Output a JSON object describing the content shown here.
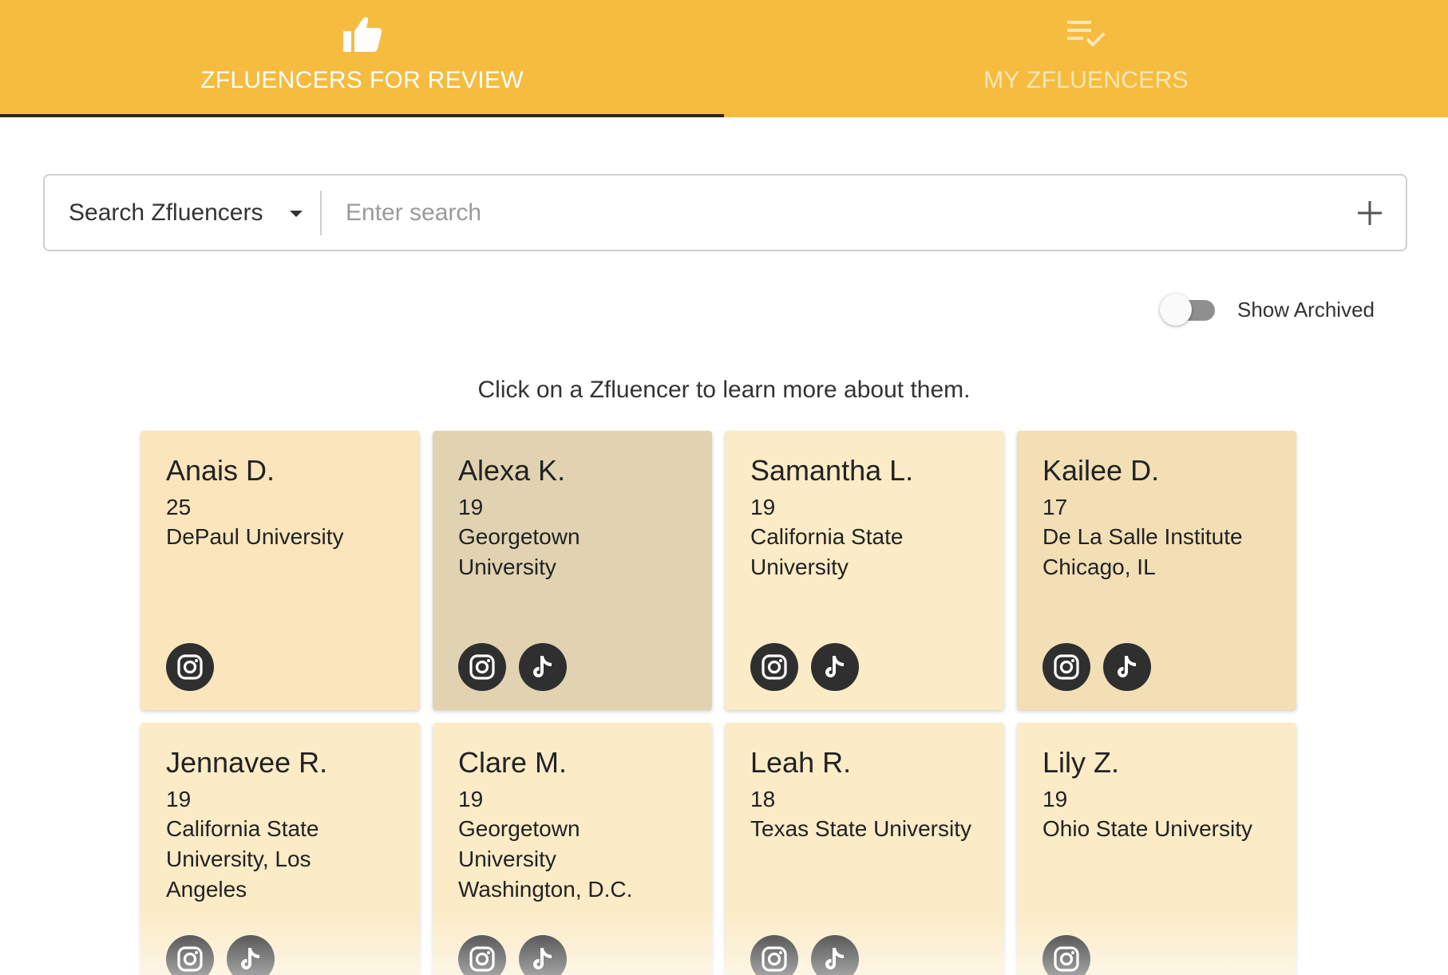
{
  "tabs": [
    {
      "label": "ZFLUENCERS FOR REVIEW",
      "icon": "thumbs-up-icon",
      "active": true
    },
    {
      "label": "MY ZFLUENCERS",
      "icon": "playlist-check-icon",
      "active": false
    }
  ],
  "search": {
    "select_label": "Search Zfluencers",
    "placeholder": "Enter search",
    "add_icon": "plus-icon"
  },
  "archived": {
    "label": "Show Archived",
    "on": false
  },
  "hint": "Click on a Zfluencer to learn more about them.",
  "colors": {
    "accent": "#f5bc40",
    "card_light": "#fbeac0",
    "card_selected": "#e1d3b1",
    "card_hover": "#f0dcb0",
    "card_default": "#fbebc6",
    "social_bg": "#2f2f2f"
  },
  "cards": [
    {
      "name": "Anais D.",
      "age": "25",
      "info": [
        "DePaul University"
      ],
      "socials": [
        "instagram-icon"
      ],
      "bg": "#fae5bc"
    },
    {
      "name": "Alexa K.",
      "age": "19",
      "info": [
        "Georgetown",
        "University"
      ],
      "socials": [
        "instagram-icon",
        "tiktok-icon"
      ],
      "bg": "#e1d3b1"
    },
    {
      "name": "Samantha L.",
      "age": "19",
      "info": [
        "California State",
        "University"
      ],
      "socials": [
        "instagram-icon",
        "tiktok-icon"
      ],
      "bg": "#fbebc6"
    },
    {
      "name": "Kailee D.",
      "age": "17",
      "info": [
        "De La Salle Institute",
        "Chicago, IL"
      ],
      "socials": [
        "instagram-icon",
        "tiktok-icon"
      ],
      "bg": "#f2dfb5"
    },
    {
      "name": "Jennavee R.",
      "age": "19",
      "info": [
        "California State",
        "University, Los",
        "Angeles"
      ],
      "socials": [
        "instagram-icon",
        "tiktok-icon"
      ],
      "bg": "#fbebc6"
    },
    {
      "name": "Clare M.",
      "age": "19",
      "info": [
        "Georgetown",
        "University",
        "Washington, D.C."
      ],
      "socials": [
        "instagram-icon",
        "tiktok-icon"
      ],
      "bg": "#fbebc6"
    },
    {
      "name": "Leah R.",
      "age": "18",
      "info": [
        "Texas State University"
      ],
      "socials": [
        "instagram-icon",
        "tiktok-icon"
      ],
      "bg": "#fbebc6"
    },
    {
      "name": "Lily Z.",
      "age": "19",
      "info": [
        "Ohio State University"
      ],
      "socials": [
        "instagram-icon"
      ],
      "bg": "#fbebc6"
    }
  ]
}
